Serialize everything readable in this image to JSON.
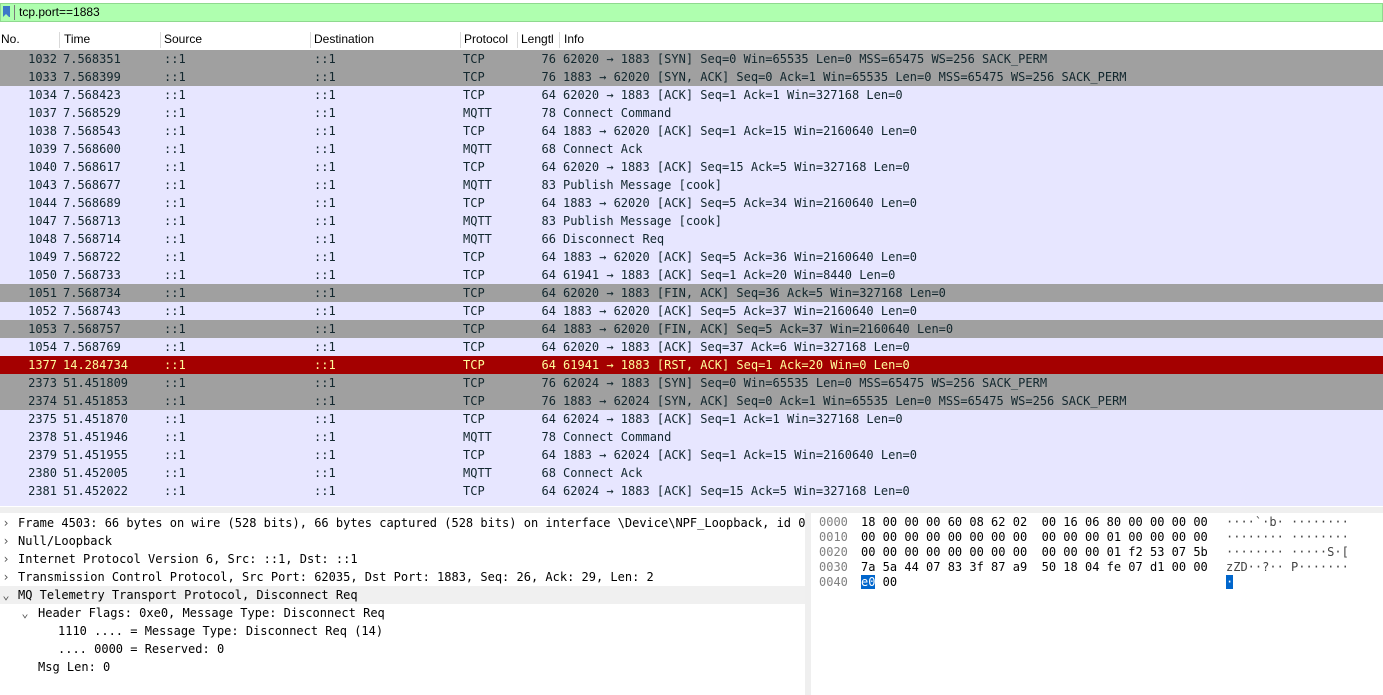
{
  "filter": {
    "value": "tcp.port==1883"
  },
  "columns": [
    "No.",
    "Time",
    "Source",
    "Destination",
    "Protocol",
    "Lengtl",
    "Info"
  ],
  "colors": {
    "tcp_mqtt_bg": "#e7e6ff",
    "syn_fin_bg": "#a0a0a0",
    "rst_bg": "#a40000",
    "rst_fg": "#fffc9c",
    "filter_ok": "#afffaf"
  },
  "packets": [
    {
      "no": "1032",
      "time": "7.568351",
      "src": "::1",
      "dst": "::1",
      "proto": "TCP",
      "len": "76",
      "info": "62020 → 1883 [SYN] Seq=0 Win=65535 Len=0 MSS=65475 WS=256 SACK_PERM",
      "style": "gray"
    },
    {
      "no": "1033",
      "time": "7.568399",
      "src": "::1",
      "dst": "::1",
      "proto": "TCP",
      "len": "76",
      "info": "1883 → 62020 [SYN, ACK] Seq=0 Ack=1 Win=65535 Len=0 MSS=65475 WS=256 SACK_PERM",
      "style": "gray"
    },
    {
      "no": "1034",
      "time": "7.568423",
      "src": "::1",
      "dst": "::1",
      "proto": "TCP",
      "len": "64",
      "info": "62020 → 1883 [ACK] Seq=1 Ack=1 Win=327168 Len=0",
      "style": "normal"
    },
    {
      "no": "1037",
      "time": "7.568529",
      "src": "::1",
      "dst": "::1",
      "proto": "MQTT",
      "len": "78",
      "info": "Connect Command",
      "style": "normal"
    },
    {
      "no": "1038",
      "time": "7.568543",
      "src": "::1",
      "dst": "::1",
      "proto": "TCP",
      "len": "64",
      "info": "1883 → 62020 [ACK] Seq=1 Ack=15 Win=2160640 Len=0",
      "style": "normal"
    },
    {
      "no": "1039",
      "time": "7.568600",
      "src": "::1",
      "dst": "::1",
      "proto": "MQTT",
      "len": "68",
      "info": "Connect Ack",
      "style": "normal"
    },
    {
      "no": "1040",
      "time": "7.568617",
      "src": "::1",
      "dst": "::1",
      "proto": "TCP",
      "len": "64",
      "info": "62020 → 1883 [ACK] Seq=15 Ack=5 Win=327168 Len=0",
      "style": "normal"
    },
    {
      "no": "1043",
      "time": "7.568677",
      "src": "::1",
      "dst": "::1",
      "proto": "MQTT",
      "len": "83",
      "info": "Publish Message [cook]",
      "style": "normal"
    },
    {
      "no": "1044",
      "time": "7.568689",
      "src": "::1",
      "dst": "::1",
      "proto": "TCP",
      "len": "64",
      "info": "1883 → 62020 [ACK] Seq=5 Ack=34 Win=2160640 Len=0",
      "style": "normal"
    },
    {
      "no": "1047",
      "time": "7.568713",
      "src": "::1",
      "dst": "::1",
      "proto": "MQTT",
      "len": "83",
      "info": "Publish Message [cook]",
      "style": "normal"
    },
    {
      "no": "1048",
      "time": "7.568714",
      "src": "::1",
      "dst": "::1",
      "proto": "MQTT",
      "len": "66",
      "info": "Disconnect Req",
      "style": "normal"
    },
    {
      "no": "1049",
      "time": "7.568722",
      "src": "::1",
      "dst": "::1",
      "proto": "TCP",
      "len": "64",
      "info": "1883 → 62020 [ACK] Seq=5 Ack=36 Win=2160640 Len=0",
      "style": "normal"
    },
    {
      "no": "1050",
      "time": "7.568733",
      "src": "::1",
      "dst": "::1",
      "proto": "TCP",
      "len": "64",
      "info": "61941 → 1883 [ACK] Seq=1 Ack=20 Win=8440 Len=0",
      "style": "normal"
    },
    {
      "no": "1051",
      "time": "7.568734",
      "src": "::1",
      "dst": "::1",
      "proto": "TCP",
      "len": "64",
      "info": "62020 → 1883 [FIN, ACK] Seq=36 Ack=5 Win=327168 Len=0",
      "style": "gray"
    },
    {
      "no": "1052",
      "time": "7.568743",
      "src": "::1",
      "dst": "::1",
      "proto": "TCP",
      "len": "64",
      "info": "1883 → 62020 [ACK] Seq=5 Ack=37 Win=2160640 Len=0",
      "style": "normal"
    },
    {
      "no": "1053",
      "time": "7.568757",
      "src": "::1",
      "dst": "::1",
      "proto": "TCP",
      "len": "64",
      "info": "1883 → 62020 [FIN, ACK] Seq=5 Ack=37 Win=2160640 Len=0",
      "style": "gray"
    },
    {
      "no": "1054",
      "time": "7.568769",
      "src": "::1",
      "dst": "::1",
      "proto": "TCP",
      "len": "64",
      "info": "62020 → 1883 [ACK] Seq=37 Ack=6 Win=327168 Len=0",
      "style": "normal"
    },
    {
      "no": "1377",
      "time": "14.284734",
      "src": "::1",
      "dst": "::1",
      "proto": "TCP",
      "len": "64",
      "info": "61941 → 1883 [RST, ACK] Seq=1 Ack=20 Win=0 Len=0",
      "style": "rst"
    },
    {
      "no": "2373",
      "time": "51.451809",
      "src": "::1",
      "dst": "::1",
      "proto": "TCP",
      "len": "76",
      "info": "62024 → 1883 [SYN] Seq=0 Win=65535 Len=0 MSS=65475 WS=256 SACK_PERM",
      "style": "gray"
    },
    {
      "no": "2374",
      "time": "51.451853",
      "src": "::1",
      "dst": "::1",
      "proto": "TCP",
      "len": "76",
      "info": "1883 → 62024 [SYN, ACK] Seq=0 Ack=1 Win=65535 Len=0 MSS=65475 WS=256 SACK_PERM",
      "style": "gray"
    },
    {
      "no": "2375",
      "time": "51.451870",
      "src": "::1",
      "dst": "::1",
      "proto": "TCP",
      "len": "64",
      "info": "62024 → 1883 [ACK] Seq=1 Ack=1 Win=327168 Len=0",
      "style": "normal"
    },
    {
      "no": "2378",
      "time": "51.451946",
      "src": "::1",
      "dst": "::1",
      "proto": "MQTT",
      "len": "78",
      "info": "Connect Command",
      "style": "normal"
    },
    {
      "no": "2379",
      "time": "51.451955",
      "src": "::1",
      "dst": "::1",
      "proto": "TCP",
      "len": "64",
      "info": "1883 → 62024 [ACK] Seq=1 Ack=15 Win=2160640 Len=0",
      "style": "normal"
    },
    {
      "no": "2380",
      "time": "51.452005",
      "src": "::1",
      "dst": "::1",
      "proto": "MQTT",
      "len": "68",
      "info": "Connect Ack",
      "style": "normal"
    },
    {
      "no": "2381",
      "time": "51.452022",
      "src": "::1",
      "dst": "::1",
      "proto": "TCP",
      "len": "64",
      "info": "62024 → 1883 [ACK] Seq=15 Ack=5 Win=327168 Len=0",
      "style": "normal"
    }
  ],
  "details": [
    {
      "arrow": "›",
      "indent": 0,
      "text": "Frame 4503: 66 bytes on wire (528 bits), 66 bytes captured (528 bits) on interface \\Device\\NPF_Loopback, id 0",
      "sel": false
    },
    {
      "arrow": "›",
      "indent": 0,
      "text": "Null/Loopback",
      "sel": false
    },
    {
      "arrow": "›",
      "indent": 0,
      "text": "Internet Protocol Version 6, Src: ::1, Dst: ::1",
      "sel": false
    },
    {
      "arrow": "›",
      "indent": 0,
      "text": "Transmission Control Protocol, Src Port: 62035, Dst Port: 1883, Seq: 26, Ack: 29, Len: 2",
      "sel": false
    },
    {
      "arrow": "⌄",
      "indent": 0,
      "text": "MQ Telemetry Transport Protocol, Disconnect Req",
      "sel": true
    },
    {
      "arrow": "⌄",
      "indent": 1,
      "text": "Header Flags: 0xe0, Message Type: Disconnect Req",
      "sel": false
    },
    {
      "arrow": "",
      "indent": 2,
      "text": "1110 .... = Message Type: Disconnect Req (14)",
      "sel": false
    },
    {
      "arrow": "",
      "indent": 2,
      "text": ".... 0000 = Reserved: 0",
      "sel": false
    },
    {
      "arrow": "",
      "indent": 1,
      "text": "Msg Len: 0",
      "sel": false
    }
  ],
  "bytes": [
    {
      "offset": "0000",
      "hex": "18 00 00 00 60 08 62 02  00 16 06 80 00 00 00 00",
      "ascii": "····`·b· ········"
    },
    {
      "offset": "0010",
      "hex": "00 00 00 00 00 00 00 00  00 00 00 01 00 00 00 00",
      "ascii": "········ ········"
    },
    {
      "offset": "0020",
      "hex": "00 00 00 00 00 00 00 00  00 00 00 01 f2 53 07 5b",
      "ascii": "········ ·····S·["
    },
    {
      "offset": "0030",
      "hex": "7a 5a 44 07 83 3f 87 a9  50 18 04 fe 07 d1 00 00",
      "ascii": "zZD··?·· P·······"
    },
    {
      "offset": "0040",
      "hex_sel": "e0",
      "hex_rest": " 00",
      "ascii_sel": "·",
      "ascii_rest": ""
    }
  ]
}
